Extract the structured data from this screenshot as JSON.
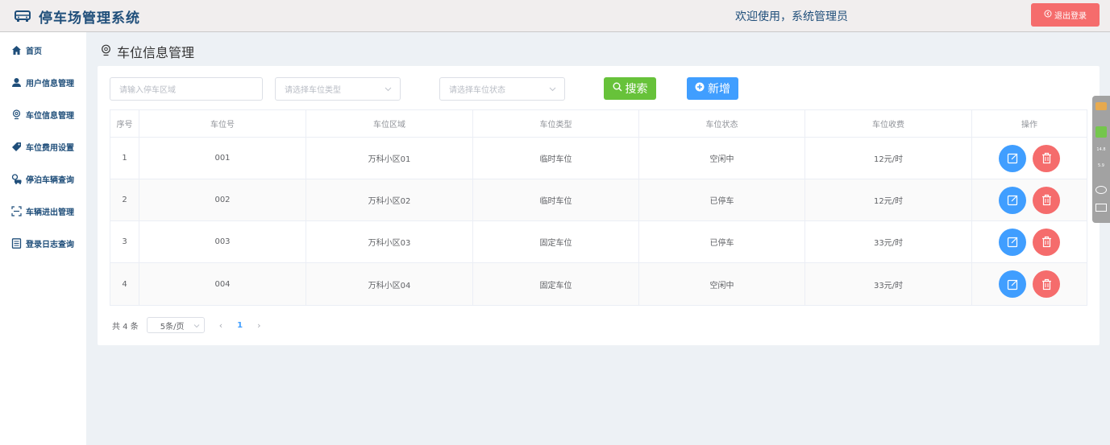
{
  "header": {
    "title": "停车场管理系统",
    "welcome": "欢迎使用，系统管理员",
    "logout_label": "退出登录",
    "logout_color": "#f56c6c"
  },
  "sidebar": {
    "items": [
      {
        "label": "首页",
        "icon": "home-icon"
      },
      {
        "label": "用户信息管理",
        "icon": "user-icon"
      },
      {
        "label": "车位信息管理",
        "icon": "location-icon"
      },
      {
        "label": "车位费用设置",
        "icon": "tag-icon"
      },
      {
        "label": "停泊车辆查询",
        "icon": "car-search-icon"
      },
      {
        "label": "车辆进出管理",
        "icon": "scan-icon"
      },
      {
        "label": "登录日志查询",
        "icon": "log-icon"
      }
    ]
  },
  "page": {
    "title": "车位信息管理"
  },
  "filters": {
    "area_placeholder": "请输入停车区域",
    "type_placeholder": "请选择车位类型",
    "status_placeholder": "请选择车位状态",
    "search_label": "搜索",
    "add_label": "新增",
    "search_color": "#67c23a",
    "add_color": "#409eff"
  },
  "table": {
    "headers": [
      "序号",
      "车位号",
      "车位区域",
      "车位类型",
      "车位状态",
      "车位收费",
      "操作"
    ],
    "rows": [
      [
        "1",
        "001",
        "万科小区01",
        "临时车位",
        "空闲中",
        "12元/时"
      ],
      [
        "2",
        "002",
        "万科小区02",
        "临时车位",
        "已停车",
        "12元/时"
      ],
      [
        "3",
        "003",
        "万科小区03",
        "固定车位",
        "已停车",
        "33元/时"
      ],
      [
        "4",
        "004",
        "万科小区04",
        "固定车位",
        "空闲中",
        "33元/时"
      ]
    ]
  },
  "pagination": {
    "total": "共 4 条",
    "page_size": "5条/页",
    "current_page": "1"
  },
  "widget": {
    "values": [
      "14.8",
      "5.9"
    ]
  }
}
